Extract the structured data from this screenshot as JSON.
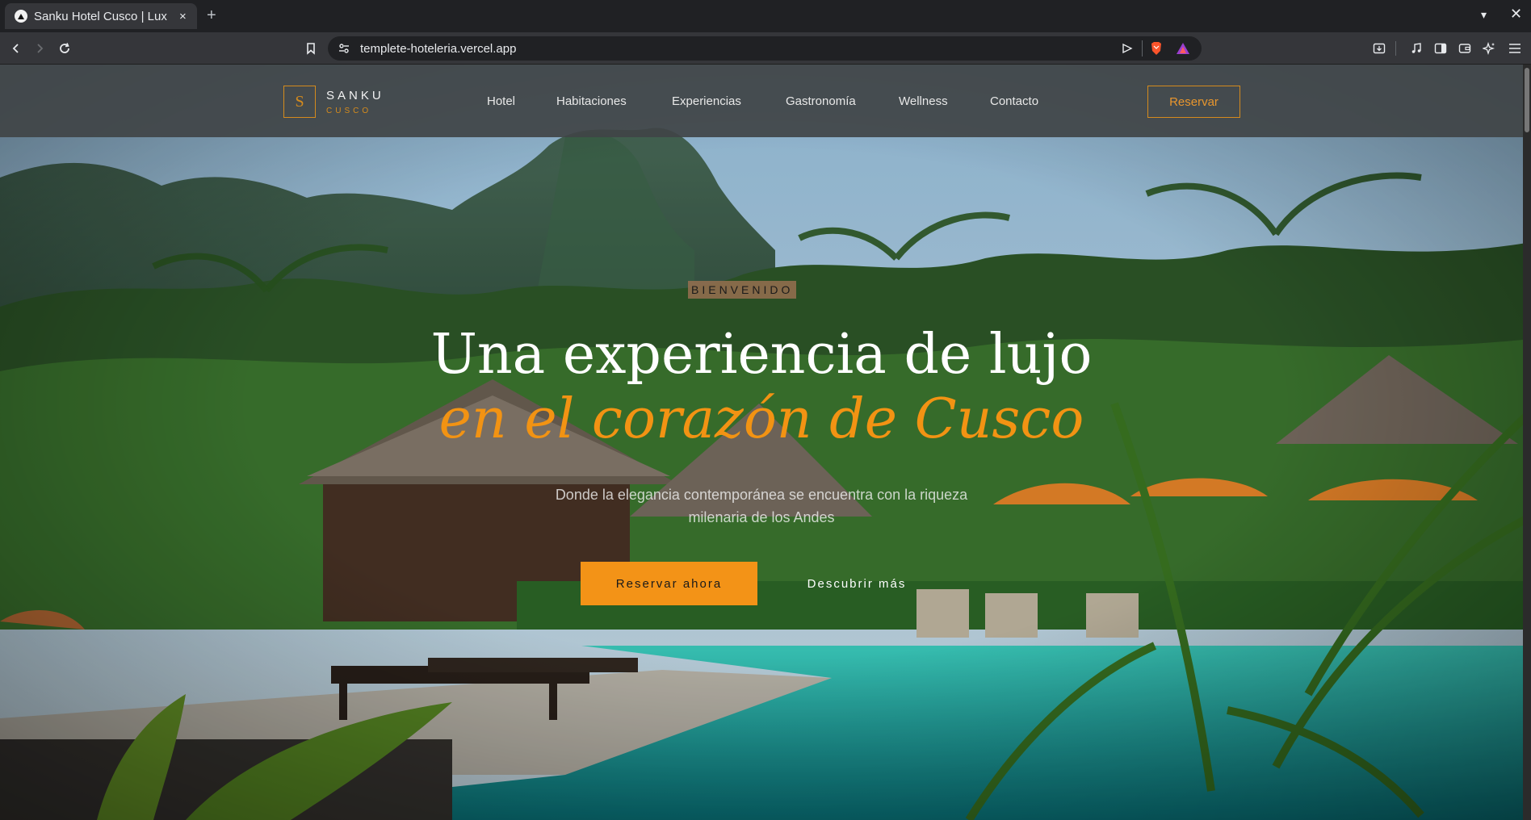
{
  "browser": {
    "tab_title": "Sanku Hotel Cusco | Lux",
    "tab_close": "×",
    "new_tab": "+",
    "url": "templete-hoteleria.vercel.app"
  },
  "header": {
    "logo_letter": "S",
    "logo_name": "SANKU",
    "logo_sub": "CUSCO",
    "nav": [
      "Hotel",
      "Habitaciones",
      "Experiencias",
      "Gastronomía",
      "Wellness",
      "Contacto"
    ],
    "reserve_label": "Reservar"
  },
  "hero": {
    "badge": "BIENVENIDO",
    "title_line1": "Una experiencia de lujo",
    "title_line2": "en el corazón de Cusco",
    "subtitle_line1": "Donde la elegancia contemporánea se encuentra con la riqueza",
    "subtitle_line2": "milenaria de los Andes",
    "book_button": "Reservar ahora",
    "more_button": "Descubrir más"
  },
  "colors": {
    "accent": "#f39317",
    "header_bg": "#404446"
  }
}
